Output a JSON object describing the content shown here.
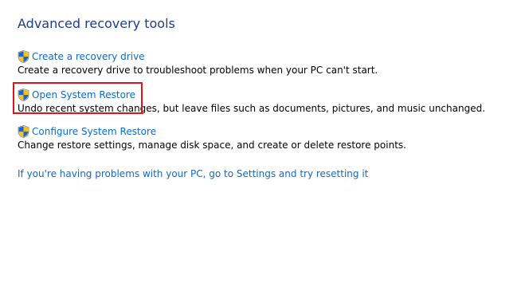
{
  "title": "Advanced recovery tools",
  "tools": [
    {
      "icon": "uac-shield-icon",
      "link": "Create a recovery drive",
      "description": "Create a recovery drive to troubleshoot problems when your PC can't start."
    },
    {
      "icon": "uac-shield-icon",
      "link": "Open System Restore",
      "description": "Undo recent system changes, but leave files such as documents, pictures, and music unchanged."
    },
    {
      "icon": "uac-shield-icon",
      "link": "Configure System Restore",
      "description": "Change restore settings, manage disk space, and create or delete restore points."
    }
  ],
  "reset_link": "If you're having problems with your PC, go to Settings and try resetting it",
  "colors": {
    "title": "#1e3c8c",
    "link": "#0d6acb",
    "highlight": "#e0111a"
  }
}
